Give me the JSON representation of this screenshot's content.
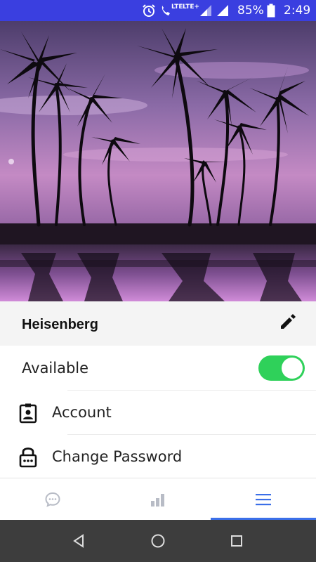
{
  "status_bar": {
    "network_label": "LTE+",
    "call_network_label": "LTE",
    "battery": "85%",
    "time": "2:49",
    "icons": [
      "alarm-icon",
      "volte-call-icon",
      "signal-icon",
      "signal-icon",
      "battery-icon"
    ]
  },
  "header": {
    "image": "palm-trees-sunset-photo"
  },
  "profile": {
    "name": "Heisenberg",
    "edit_icon": "pencil-icon"
  },
  "settings": {
    "available_label": "Available",
    "available_on": true,
    "account_label": "Account",
    "account_icon": "account-badge-icon",
    "change_password_label": "Change Password",
    "change_password_icon": "lock-icon"
  },
  "tabs": [
    {
      "icon": "chat-icon",
      "active": false
    },
    {
      "icon": "bar-chart-icon",
      "active": false
    },
    {
      "icon": "menu-icon",
      "active": true
    }
  ],
  "colors": {
    "status_bar": "#3a3fe0",
    "toggle_on": "#2fd15a",
    "active_tab": "#3b6fe8",
    "inactive_tab": "#b8bcc6",
    "nav_bar": "#3d3d3d"
  },
  "nav": [
    "back-icon",
    "home-icon",
    "recents-icon"
  ]
}
